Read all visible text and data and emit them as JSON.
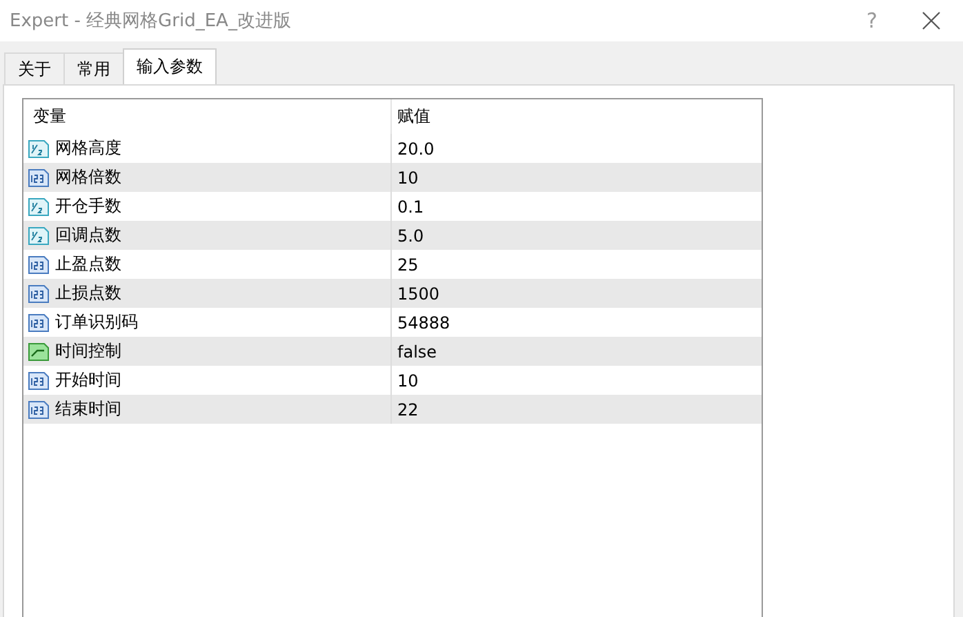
{
  "window": {
    "title": "Expert - 经典网格Grid_EA_改进版",
    "help": "?"
  },
  "tabs": [
    {
      "label": "关于",
      "selected": false
    },
    {
      "label": "常用",
      "selected": false
    },
    {
      "label": "输入参数",
      "selected": true
    }
  ],
  "table": {
    "columns": [
      "变量",
      "赋值"
    ],
    "rows": [
      {
        "kind": "double",
        "name": "网格高度",
        "value": "20.0"
      },
      {
        "kind": "integer",
        "name": "网格倍数",
        "value": "10"
      },
      {
        "kind": "double",
        "name": "开仓手数",
        "value": "0.1"
      },
      {
        "kind": "double",
        "name": "回调点数",
        "value": "5.0"
      },
      {
        "kind": "integer",
        "name": "止盈点数",
        "value": "25"
      },
      {
        "kind": "integer",
        "name": "止损点数",
        "value": "1500"
      },
      {
        "kind": "integer",
        "name": "订单识别码",
        "value": "54888"
      },
      {
        "kind": "bool",
        "name": "时间控制",
        "value": "false"
      },
      {
        "kind": "integer",
        "name": "开始时间",
        "value": "10"
      },
      {
        "kind": "integer",
        "name": "结束时间",
        "value": "22"
      }
    ]
  }
}
